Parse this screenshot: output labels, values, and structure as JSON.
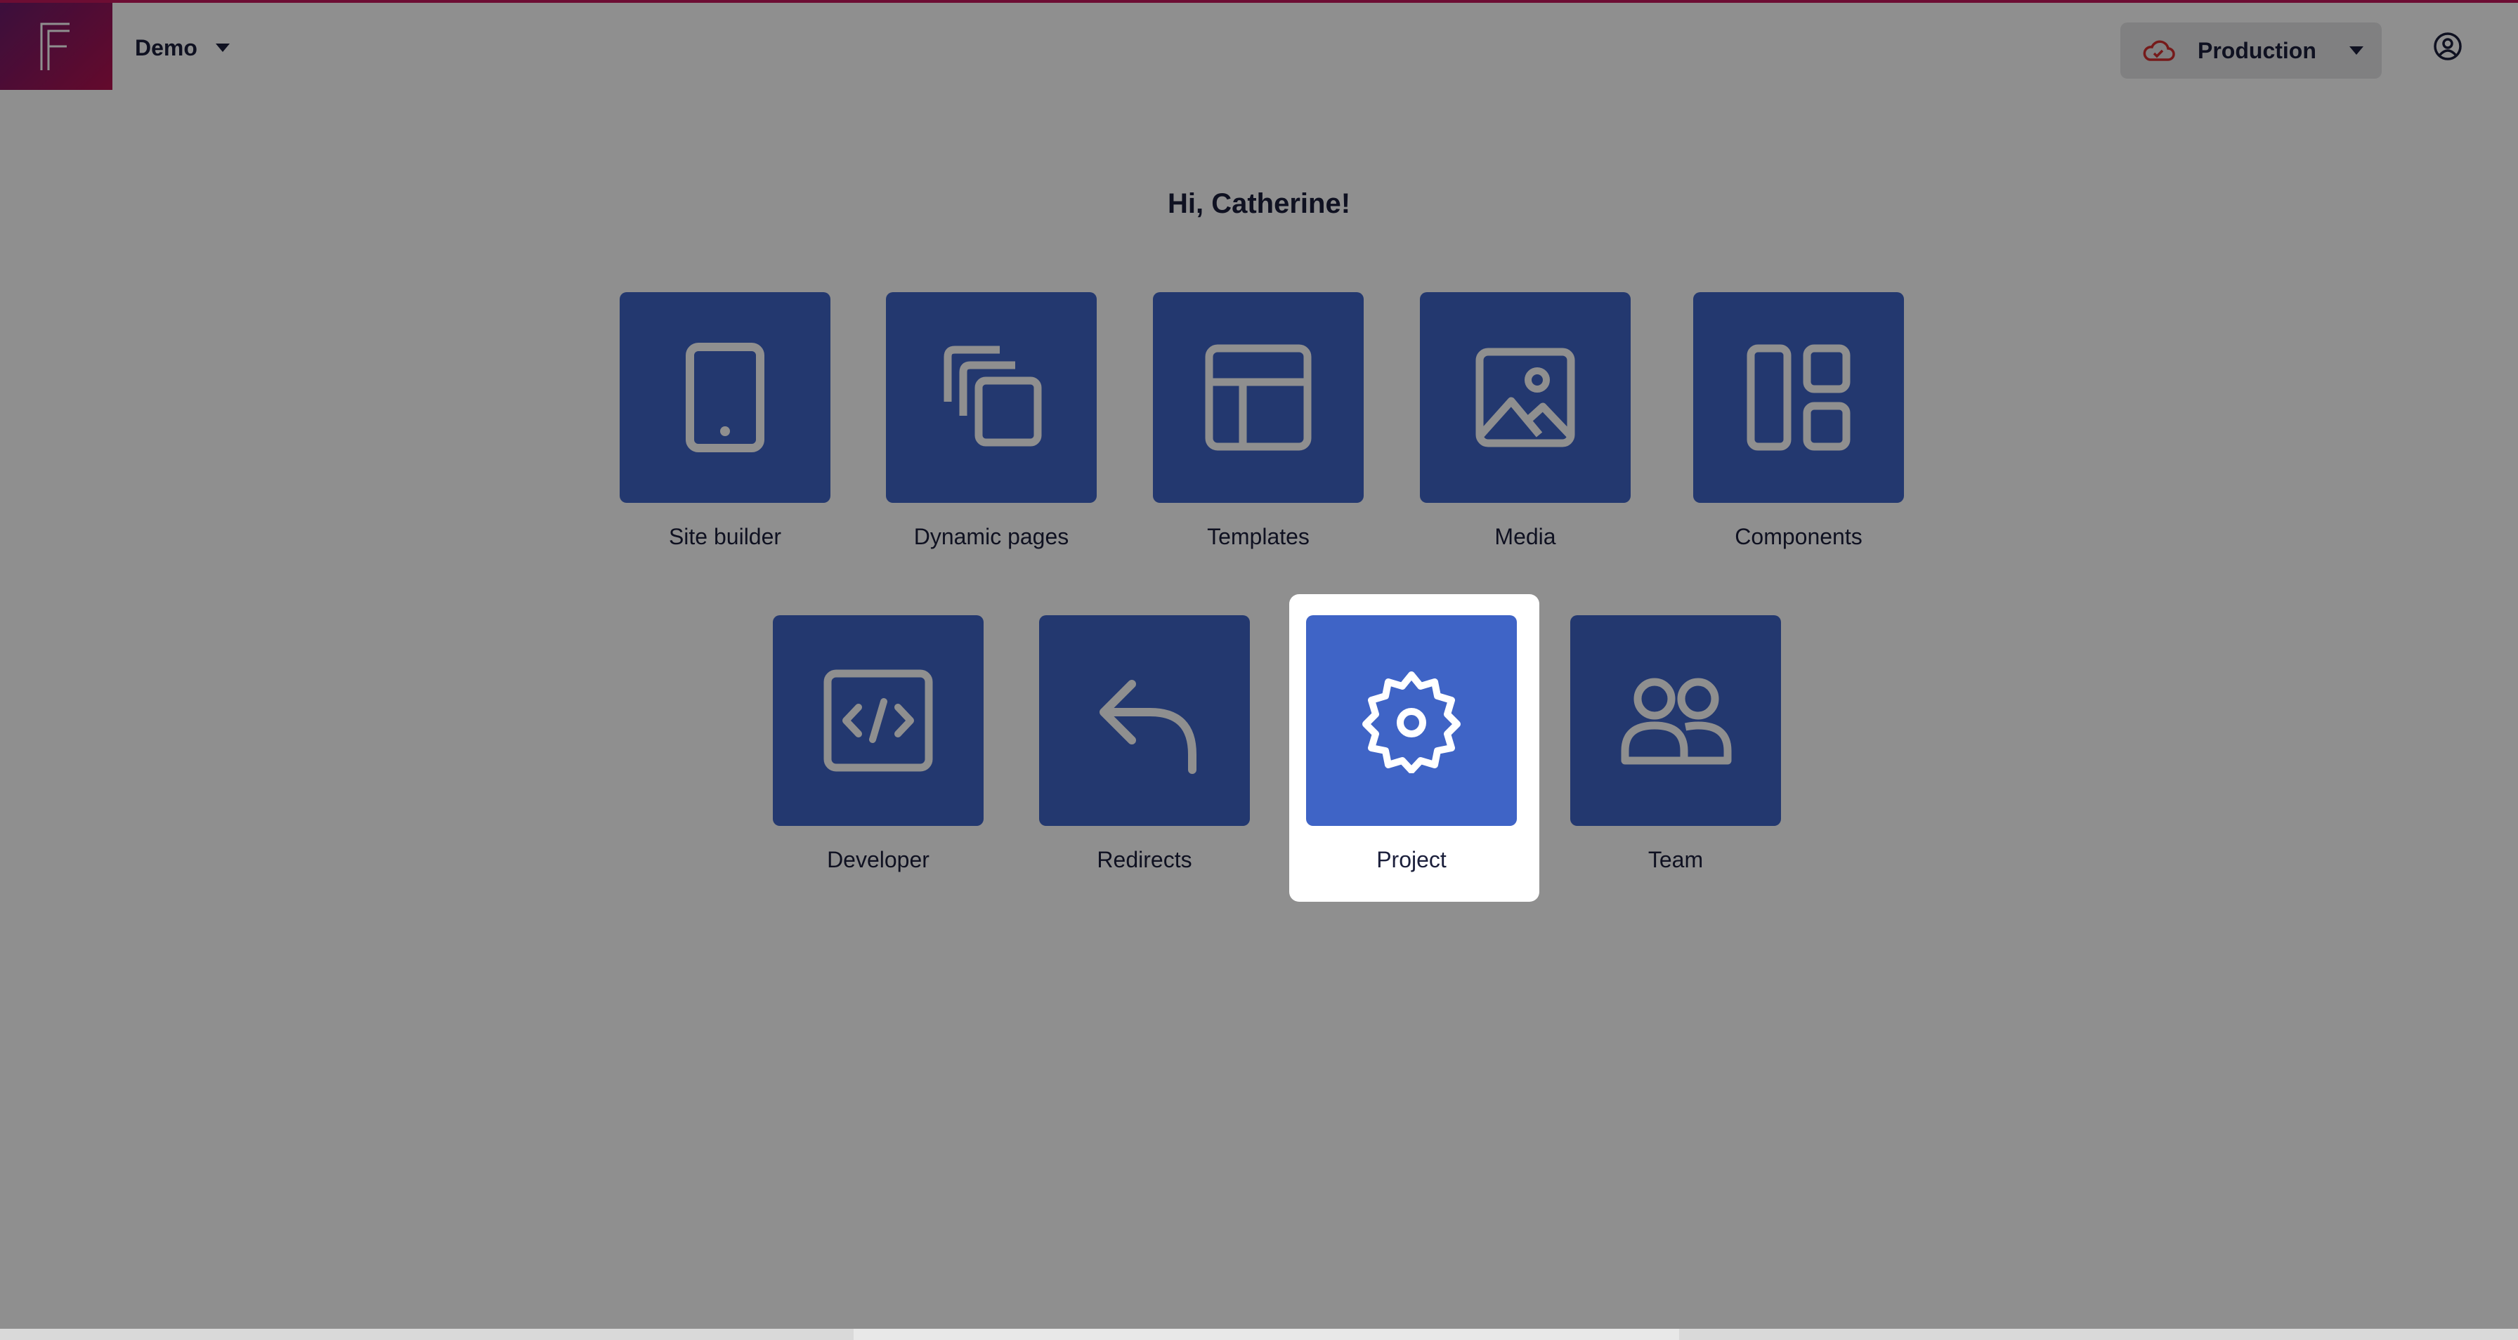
{
  "header": {
    "project_name": "Demo",
    "environment": "Production",
    "colors": {
      "logo_gradient_start": "#6a1b6b",
      "logo_gradient_end": "#b3124f",
      "env_cloud": "#d32f2f"
    }
  },
  "main": {
    "greeting": "Hi, Catherine!",
    "tiles_row1": [
      {
        "label": "Site builder",
        "icon": "tablet-icon"
      },
      {
        "label": "Dynamic pages",
        "icon": "stacked-pages-icon"
      },
      {
        "label": "Templates",
        "icon": "layout-template-icon"
      },
      {
        "label": "Media",
        "icon": "image-icon"
      },
      {
        "label": "Components",
        "icon": "components-grid-icon"
      }
    ],
    "tiles_row2": [
      {
        "label": "Developer",
        "icon": "code-icon"
      },
      {
        "label": "Redirects",
        "icon": "redirect-arrow-icon"
      },
      {
        "label": "Project",
        "icon": "gear-icon",
        "highlighted": true
      },
      {
        "label": "Team",
        "icon": "team-icon"
      }
    ]
  },
  "colors": {
    "tile": "#3f64c6",
    "overlay": "rgba(0,0,0,0.44)",
    "text": "#1b1f3b"
  }
}
